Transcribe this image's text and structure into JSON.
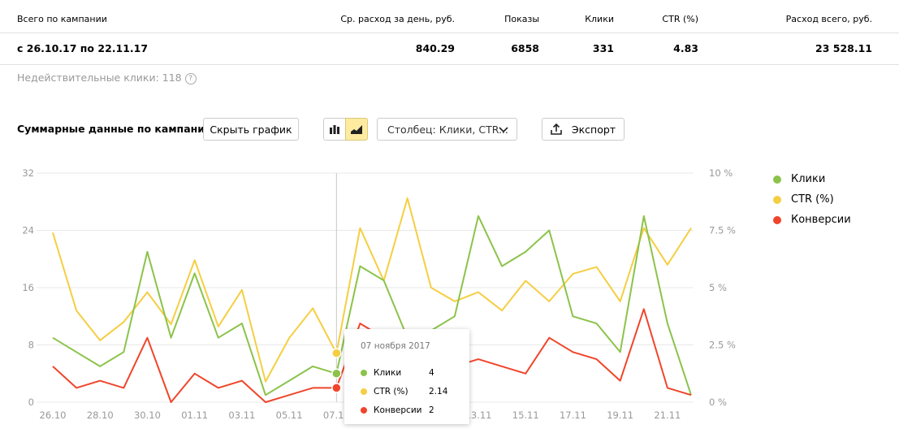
{
  "summary": {
    "headers": [
      "Всего по кампании",
      "Ср. расход за день, руб.",
      "Показы",
      "Клики",
      "CTR (%)",
      "Расход всего, руб."
    ],
    "values": [
      "с 26.10.17 по 22.11.17",
      "840.29",
      "6858",
      "331",
      "4.83",
      "23 528.11"
    ]
  },
  "invalid_clicks": "Недействительные клики: 118",
  "invalid_help": "?",
  "section_title": "Суммарные данные по кампании",
  "toolbar": {
    "hide_chart": "Скрыть график",
    "column_select": "Столбец: Клики, CTR...",
    "export": "Экспорт"
  },
  "colors": {
    "clicks": "#8bc34a",
    "ctr": "#f5ce42",
    "conversions": "#f0452a",
    "grid": "#e8e8e8",
    "axis_text": "#999999"
  },
  "icons": {
    "bar_view": "bar-chart-icon",
    "area_view": "area-chart-icon",
    "select": "chevron-down-icon",
    "export": "export-icon"
  },
  "tooltip": {
    "date": "07 ноября 2017",
    "rows": [
      {
        "name": "Клики",
        "value": "4",
        "color": "#8bc34a"
      },
      {
        "name": "CTR (%)",
        "value": "2.14",
        "color": "#f5ce42"
      },
      {
        "name": "Конверсии",
        "value": "2",
        "color": "#f0452a"
      }
    ]
  },
  "chart_data": {
    "type": "line",
    "x": [
      "26.10",
      "27.10",
      "28.10",
      "29.10",
      "30.10",
      "31.10",
      "01.11",
      "02.11",
      "03.11",
      "04.11",
      "05.11",
      "06.11",
      "07.11",
      "08.11",
      "09.11",
      "10.11",
      "11.11",
      "12.11",
      "13.11",
      "14.11",
      "15.11",
      "16.11",
      "17.11",
      "18.11",
      "19.11",
      "20.11",
      "21.11",
      "22.11"
    ],
    "x_tick_labels": [
      "26.10",
      "28.10",
      "30.10",
      "01.11",
      "03.11",
      "05.11",
      "07.11",
      "",
      "",
      "13.11",
      "15.11",
      "17.11",
      "19.11",
      "21.11"
    ],
    "x_tick_indices": [
      0,
      2,
      4,
      6,
      8,
      10,
      12,
      14,
      16,
      18,
      20,
      22,
      24,
      26
    ],
    "y_left": {
      "min": 0,
      "max": 32,
      "ticks": [
        0,
        8,
        16,
        24,
        32
      ]
    },
    "y_right": {
      "min": 0,
      "max": 10,
      "ticks": [
        0,
        2.5,
        5,
        7.5,
        10
      ],
      "tick_labels": [
        "0 %",
        "2.5 %",
        "5 %",
        "7.5 %",
        "10 %"
      ]
    },
    "highlight_index": 12,
    "legend_position": "top-right",
    "series": [
      {
        "name": "Клики",
        "axis": "left",
        "color": "#8bc34a",
        "values": [
          9,
          7,
          5,
          7,
          21,
          9,
          18,
          9,
          11,
          1,
          3,
          5,
          4,
          19,
          17,
          9,
          10,
          12,
          26,
          19,
          21,
          24,
          12,
          11,
          7,
          26,
          11,
          1
        ]
      },
      {
        "name": "CTR (%)",
        "axis": "right",
        "color": "#f5ce42",
        "values": [
          7.4,
          4.0,
          2.7,
          3.5,
          4.8,
          3.4,
          6.2,
          3.3,
          4.9,
          0.9,
          2.8,
          4.1,
          2.14,
          7.6,
          5.3,
          8.9,
          5.0,
          4.4,
          4.8,
          4.0,
          5.3,
          4.4,
          5.6,
          5.9,
          4.4,
          7.6,
          6.0,
          7.6
        ]
      },
      {
        "name": "Конверсии",
        "axis": "left",
        "color": "#f0452a",
        "values": [
          5,
          2,
          3,
          2,
          9,
          0,
          4,
          2,
          3,
          0,
          1,
          2,
          2,
          11,
          9,
          5,
          6,
          5,
          6,
          5,
          4,
          9,
          7,
          6,
          3,
          13,
          2,
          1
        ]
      }
    ]
  }
}
